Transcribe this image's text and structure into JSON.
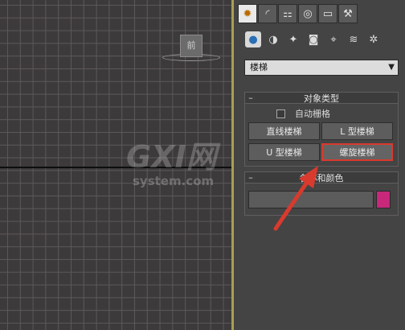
{
  "viewport": {
    "label": "前"
  },
  "panel": {
    "tabs": [
      {
        "icon": "create-tab-icon"
      },
      {
        "icon": "modify-tab-icon"
      },
      {
        "icon": "hierarchy-tab-icon"
      },
      {
        "icon": "motion-tab-icon"
      },
      {
        "icon": "display-tab-icon"
      },
      {
        "icon": "utilities-tab-icon"
      }
    ],
    "categories": [
      {
        "icon": "geometry-icon"
      },
      {
        "icon": "shapes-icon"
      },
      {
        "icon": "lights-icon"
      },
      {
        "icon": "cameras-icon"
      },
      {
        "icon": "helpers-icon"
      },
      {
        "icon": "space-warps-icon"
      },
      {
        "icon": "systems-icon"
      }
    ],
    "dropdown": {
      "value": "楼梯"
    },
    "object_type": {
      "title": "对象类型",
      "autogrid_label": "自动栅格",
      "buttons": {
        "straight": "直线楼梯",
        "l_type": "L 型楼梯",
        "u_type": "U 型楼梯",
        "spiral": "螺旋楼梯"
      }
    },
    "name_color": {
      "title": "名称和颜色",
      "name_value": "",
      "swatch_color": "#c7287a"
    }
  },
  "watermark": {
    "main": "GXI网",
    "sub": "system.com"
  },
  "colors": {
    "selection_highlight": "#d93a2e",
    "viewport_border": "#a7a051"
  }
}
